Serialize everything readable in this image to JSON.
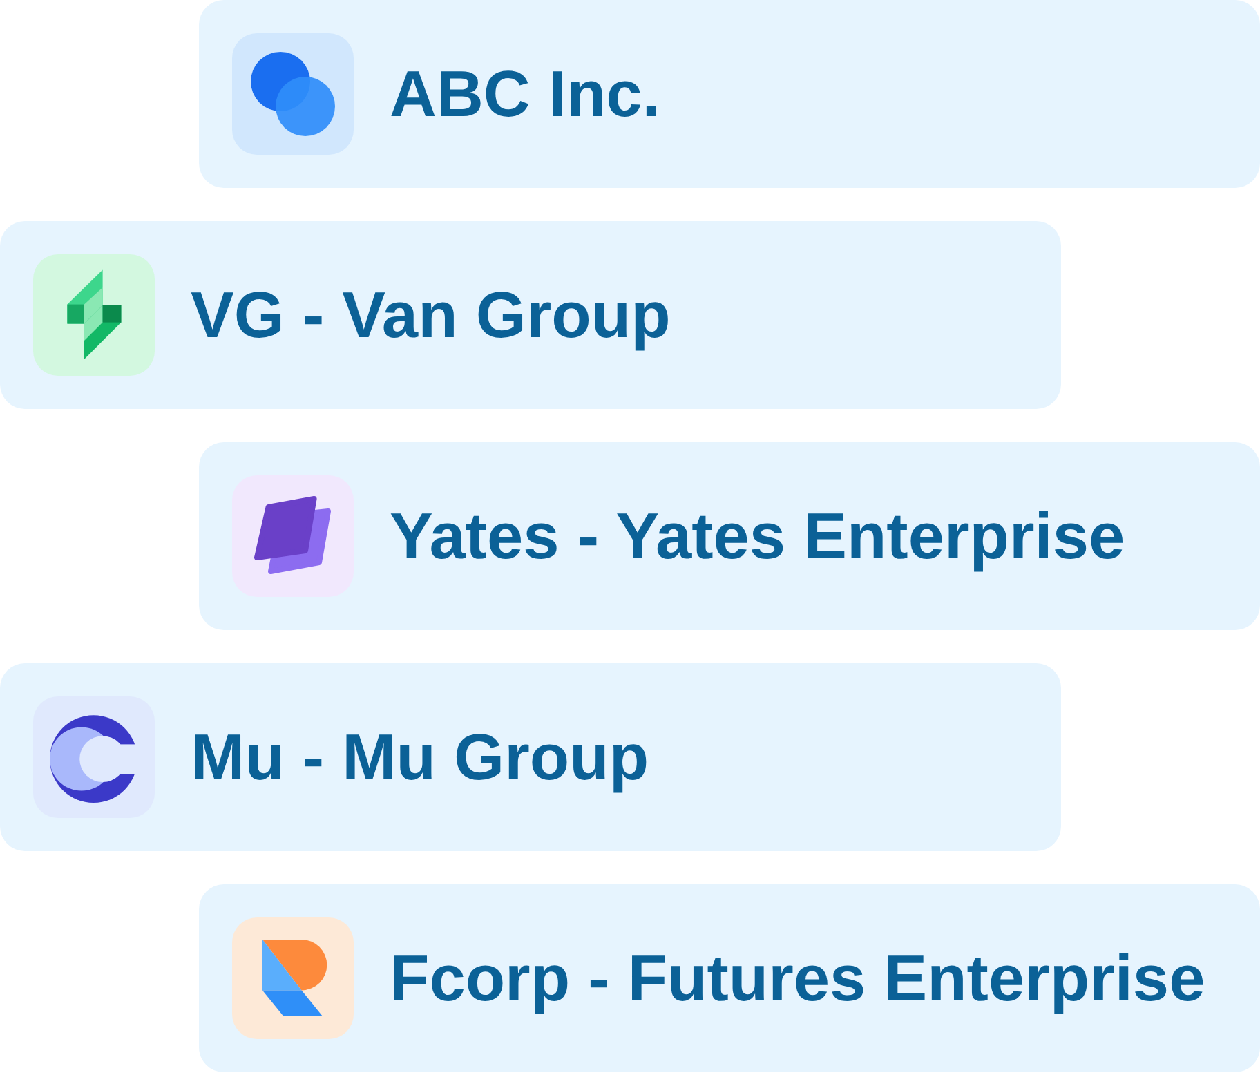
{
  "companies": [
    {
      "name": "ABC Inc.",
      "kind": "circles"
    },
    {
      "name": "VG - Van Group",
      "kind": "bolt"
    },
    {
      "name": "Yates - Yates Enterprise",
      "kind": "layers"
    },
    {
      "name": "Mu - Mu Group",
      "kind": "crescent"
    },
    {
      "name": "Fcorp - Futures Enterprise",
      "kind": "letter"
    }
  ]
}
